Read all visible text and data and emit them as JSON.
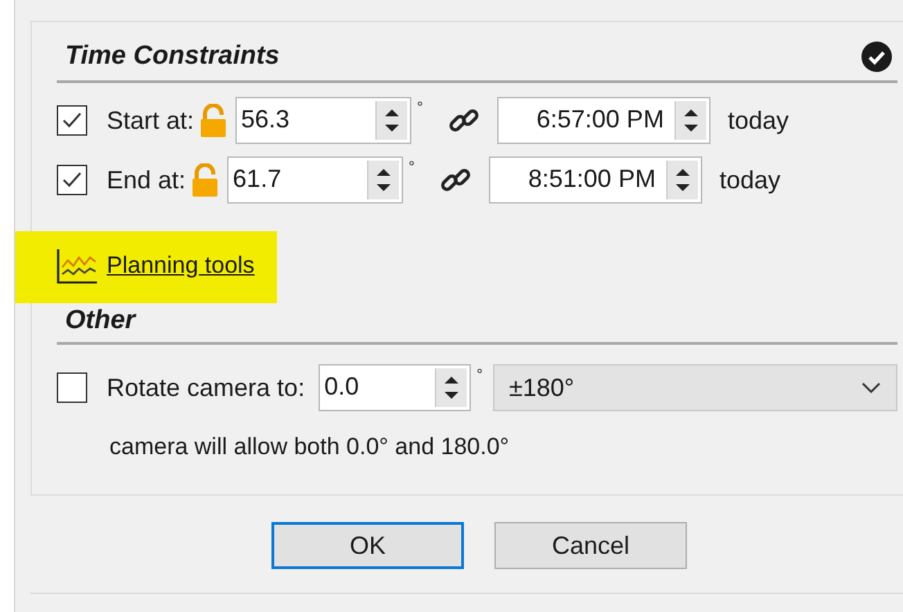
{
  "time_constraints": {
    "title": "Time Constraints",
    "rows": [
      {
        "checked": true,
        "label": "Start at:",
        "angle": "56.3",
        "degree": "°",
        "time": "6:57:00 PM",
        "day": "today"
      },
      {
        "checked": true,
        "label": "End at:",
        "angle": "61.7",
        "degree": "°",
        "time": "8:51:00 PM",
        "day": "today"
      }
    ]
  },
  "planning_link": {
    "label": "Planning tools",
    "highlighted": true
  },
  "other": {
    "title": "Other",
    "rotate": {
      "checked": false,
      "label": "Rotate camera to:",
      "value": "0.0",
      "degree": "°",
      "range": "±180°"
    },
    "note": "camera will allow both 0.0° and 180.0°"
  },
  "buttons": [
    {
      "label": "OK",
      "default": true
    },
    {
      "label": "Cancel",
      "default": false
    }
  ]
}
